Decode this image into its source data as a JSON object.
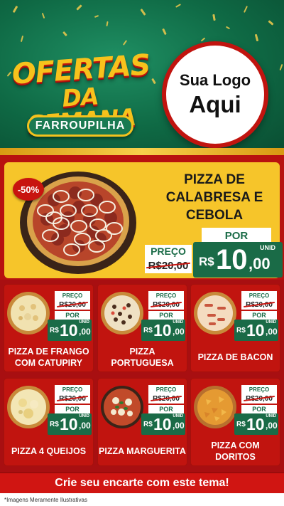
{
  "header": {
    "title_line1": "OFERTAS",
    "title_line2": "DA SEMANA",
    "city": "FARROUPILHA",
    "logo_line1": "Sua Logo",
    "logo_line2": "Aqui"
  },
  "featured": {
    "badge": "-50%",
    "name": "PIZZA DE CALABRESA E CEBOLA",
    "preco_label": "PREÇO",
    "old_price": "R$20,00",
    "por_label": "POR",
    "currency": "R$",
    "new_int": "10",
    "new_dec": ",00",
    "unit": "UNID"
  },
  "products": [
    {
      "name": "PIZZA DE FRANGO COM CATUPIRY",
      "preco_label": "PREÇO",
      "old_price": "R$20,00",
      "por_label": "POR",
      "currency": "R$",
      "new_int": "10",
      "new_dec": ",00",
      "unit": "UNID"
    },
    {
      "name": "PIZZA PORTUGUESA",
      "preco_label": "PREÇO",
      "old_price": "R$20,00",
      "por_label": "POR",
      "currency": "R$",
      "new_int": "10",
      "new_dec": ",00",
      "unit": "UNID"
    },
    {
      "name": "PIZZA DE BACON",
      "preco_label": "PREÇO",
      "old_price": "R$20,00",
      "por_label": "POR",
      "currency": "R$",
      "new_int": "10",
      "new_dec": ",00",
      "unit": "UNID"
    },
    {
      "name": "PIZZA 4 QUEIJOS",
      "preco_label": "PREÇO",
      "old_price": "R$20,00",
      "por_label": "POR",
      "currency": "R$",
      "new_int": "10",
      "new_dec": ",00",
      "unit": "UNID"
    },
    {
      "name": "PIZZA MARGUERITA",
      "preco_label": "PREÇO",
      "old_price": "R$20,00",
      "por_label": "POR",
      "currency": "R$",
      "new_int": "10",
      "new_dec": ",00",
      "unit": "UNID"
    },
    {
      "name": "PIZZA COM DORITOS",
      "preco_label": "PREÇO",
      "old_price": "R$20,00",
      "por_label": "POR",
      "currency": "R$",
      "new_int": "10",
      "new_dec": ",00",
      "unit": "UNID"
    }
  ],
  "footer": {
    "cta": "Crie seu encarte com este tema!",
    "disclaimer": "*Imagens Meramente Ilustrativas"
  },
  "colors": {
    "brand_green": "#1a6b47",
    "brand_red": "#c1140f",
    "brand_yellow": "#f6c52a"
  }
}
